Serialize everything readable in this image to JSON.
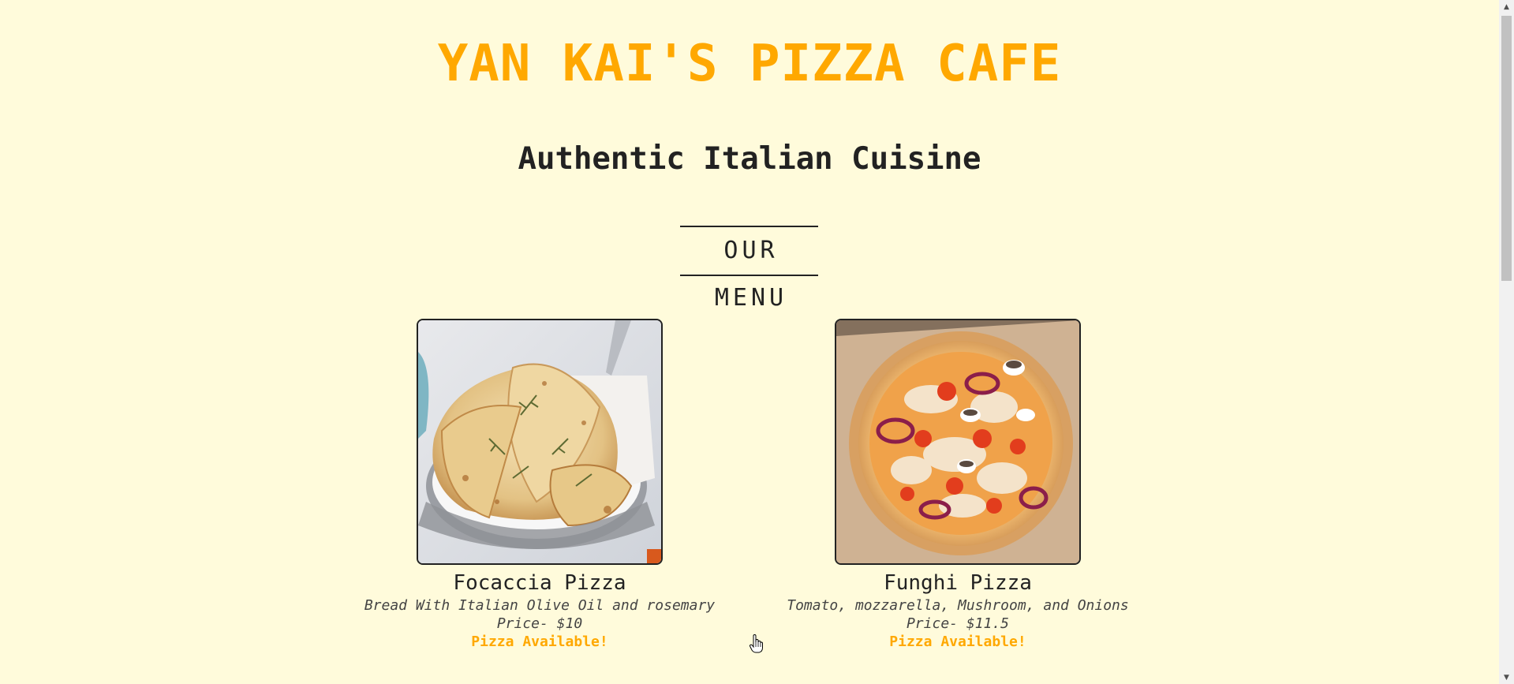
{
  "header": {
    "title": "YAN KAI'S PIZZA CAFE",
    "subtitle": "Authentic Italian Cuisine"
  },
  "menu": {
    "heading": "OUR MENU",
    "items": [
      {
        "name": "Focaccia Pizza",
        "description": "Bread With Italian Olive Oil and rosemary",
        "price": "Price- $10",
        "status": "Pizza Available!",
        "image_icon": "focaccia-photo"
      },
      {
        "name": "Funghi Pizza",
        "description": "Tomato, mozzarella, Mushroom, and Onions",
        "price": "Price- $11.5",
        "status": "Pizza Available!",
        "image_icon": "funghi-pizza-photo"
      }
    ]
  },
  "colors": {
    "background": "#fffbdb",
    "accent": "#ffa800",
    "text": "#222222"
  },
  "scrollbar": {
    "up_glyph": "▲",
    "down_glyph": "▼"
  }
}
